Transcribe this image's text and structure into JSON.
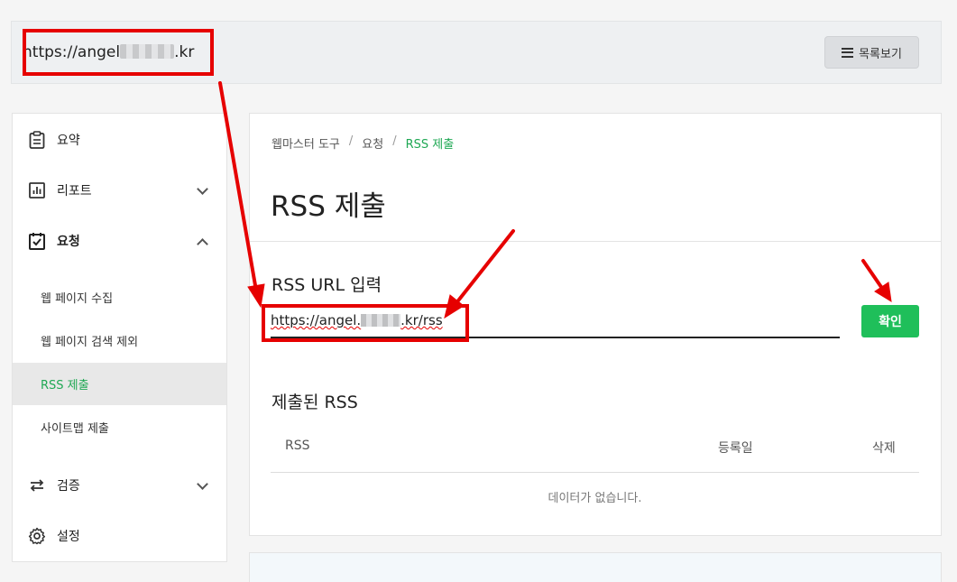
{
  "header": {
    "site_url_prefix": "https://angel",
    "site_url_suffix": ".kr",
    "list_button": "목록보기"
  },
  "sidebar": {
    "items": [
      {
        "label": "요약",
        "icon": "clipboard-icon"
      },
      {
        "label": "리포트",
        "icon": "chart-icon"
      },
      {
        "label": "요청",
        "icon": "checklist-icon"
      },
      {
        "label": "검증",
        "icon": "refresh-icon"
      },
      {
        "label": "설정",
        "icon": "gear-icon"
      }
    ],
    "sub_items": [
      {
        "label": "웹 페이지 수집"
      },
      {
        "label": "웹 페이지 검색 제외"
      },
      {
        "label": "RSS 제출"
      },
      {
        "label": "사이트맵 제출"
      }
    ]
  },
  "main": {
    "breadcrumb": [
      "웹마스터 도구",
      "요청",
      "RSS 제출"
    ],
    "title": "RSS 제출",
    "input_section_title": "RSS URL 입력",
    "input_value_prefix": "https://angel.",
    "input_value_suffix": ".kr/rss",
    "confirm_button": "확인",
    "submitted_title": "제출된 RSS",
    "table": {
      "columns": [
        "RSS",
        "등록일",
        "삭제"
      ],
      "empty_text": "데이터가 없습니다."
    }
  },
  "colors": {
    "accent_green": "#1fbf5a",
    "annotation_red": "#e60000"
  }
}
